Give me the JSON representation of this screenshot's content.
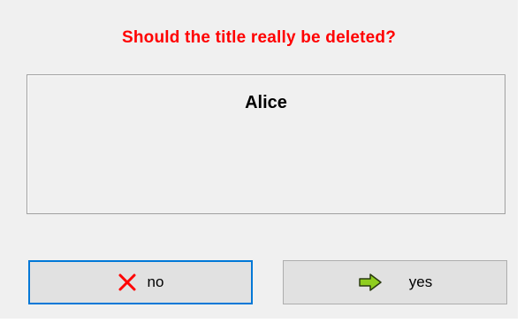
{
  "dialog": {
    "prompt": "Should the title really be deleted?",
    "title_value": "Alice",
    "buttons": {
      "no_label": "no",
      "yes_label": "yes"
    },
    "colors": {
      "prompt": "#ff0000",
      "no_icon": "#ff0000",
      "yes_icon_fill": "#8fce1f",
      "focus_border": "#0078d7"
    },
    "icons": {
      "no": "x-mark-icon",
      "yes": "right-arrow-icon"
    }
  }
}
